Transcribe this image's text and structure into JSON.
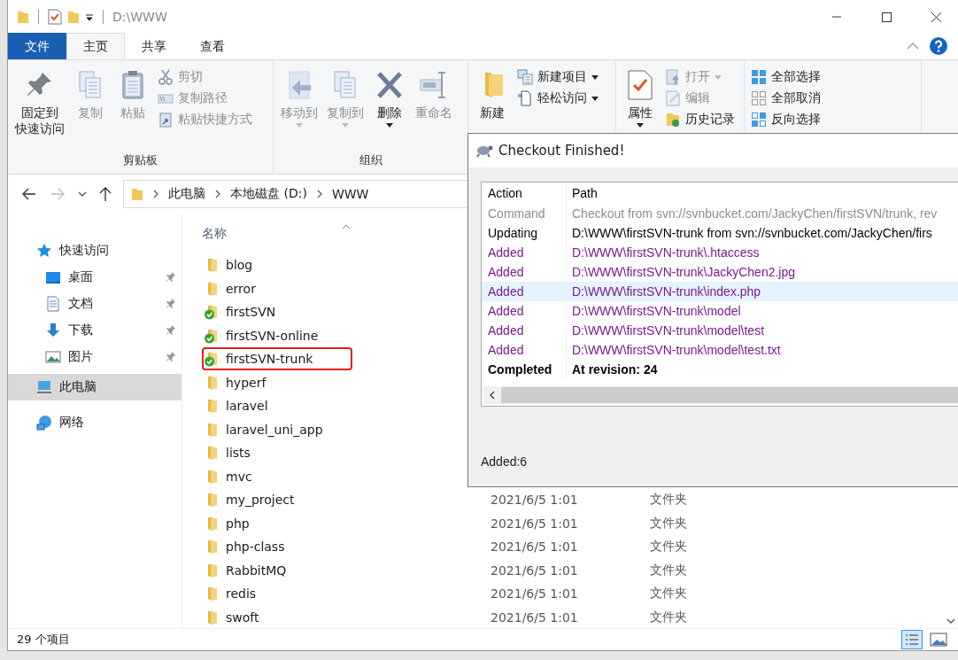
{
  "window": {
    "title": "D:\\WWW"
  },
  "ribbon_tabs": [
    {
      "label": "文件",
      "kind": "file",
      "selected": false
    },
    {
      "label": "主页",
      "kind": "tab",
      "selected": true
    },
    {
      "label": "共享",
      "kind": "tab",
      "selected": false
    },
    {
      "label": "查看",
      "kind": "tab",
      "selected": false
    }
  ],
  "ribbon_groups": [
    {
      "label": "剪贴板",
      "large": [
        {
          "lines": [
            "固定到",
            "快速访问"
          ],
          "kind": "pin",
          "disabled": false,
          "dropdown": false
        },
        {
          "label": "复制",
          "kind": "copy",
          "disabled": true,
          "dropdown": false
        },
        {
          "label": "粘贴",
          "kind": "paste",
          "disabled": true,
          "dropdown": false
        }
      ],
      "small": [
        {
          "label": "剪切",
          "kind": "cut",
          "disabled": true,
          "dropdown": false
        },
        {
          "label": "复制路径",
          "kind": "copy-path",
          "disabled": true,
          "dropdown": false
        },
        {
          "label": "粘贴快捷方式",
          "kind": "paste-shortcut",
          "disabled": true,
          "dropdown": false
        }
      ]
    },
    {
      "label": "组织",
      "large": [
        {
          "label": "移动到",
          "kind": "move",
          "disabled": true,
          "dropdown": true
        },
        {
          "label": "复制到",
          "kind": "copy-to",
          "disabled": true,
          "dropdown": true
        },
        {
          "label": "删除",
          "kind": "delete",
          "disabled": false,
          "dropdown": true
        },
        {
          "label": "重命名",
          "kind": "rename",
          "disabled": true,
          "dropdown": false
        }
      ]
    },
    {
      "large": [
        {
          "label": "新建",
          "kind": "new-folder",
          "disabled": false,
          "dropdown": false
        }
      ],
      "small": [
        {
          "label": "新建项目",
          "kind": "new-item",
          "disabled": false,
          "dropdown": true
        },
        {
          "label": "轻松访问",
          "kind": "easy-access",
          "disabled": false,
          "dropdown": true
        }
      ]
    },
    {
      "large": [
        {
          "label": "属性",
          "kind": "properties",
          "disabled": false,
          "dropdown": true
        }
      ],
      "small": [
        {
          "label": "打开",
          "kind": "open",
          "disabled": true,
          "dropdown": true
        },
        {
          "label": "编辑",
          "kind": "edit",
          "disabled": true,
          "dropdown": false
        },
        {
          "label": "历史记录",
          "kind": "history",
          "disabled": false,
          "dropdown": false
        }
      ]
    },
    {
      "small": [
        {
          "label": "全部选择",
          "kind": "select-all",
          "disabled": false,
          "dropdown": false
        },
        {
          "label": "全部取消",
          "kind": "select-none",
          "disabled": false,
          "dropdown": false
        },
        {
          "label": "反向选择",
          "kind": "invert",
          "disabled": false,
          "dropdown": false
        }
      ]
    }
  ],
  "breadcrumb": [
    "此电脑",
    "本地磁盘 (D:)",
    "WWW"
  ],
  "sidebar": [
    {
      "label": "快速访问",
      "kind": "quick",
      "pinned": false,
      "selected": false
    },
    {
      "label": "桌面",
      "kind": "desktop",
      "pinned": true,
      "selected": false
    },
    {
      "label": "文档",
      "kind": "documents",
      "pinned": true,
      "selected": false
    },
    {
      "label": "下载",
      "kind": "downloads",
      "pinned": true,
      "selected": false
    },
    {
      "label": "图片",
      "kind": "pictures",
      "pinned": true,
      "selected": false
    },
    {
      "label": "此电脑",
      "kind": "pc",
      "pinned": false,
      "selected": true
    },
    {
      "label": "网络",
      "kind": "network",
      "pinned": false,
      "selected": false
    }
  ],
  "file_list": {
    "columns": [
      "名称"
    ],
    "rows": [
      {
        "name": "blog",
        "versioned": false,
        "highlighted": false
      },
      {
        "name": "error",
        "versioned": false,
        "highlighted": false
      },
      {
        "name": "firstSVN",
        "versioned": true,
        "highlighted": false
      },
      {
        "name": "firstSVN-online",
        "versioned": true,
        "highlighted": false
      },
      {
        "name": "firstSVN-trunk",
        "versioned": true,
        "highlighted": true
      },
      {
        "name": "hyperf",
        "versioned": false,
        "highlighted": false
      },
      {
        "name": "laravel",
        "versioned": false,
        "highlighted": false
      },
      {
        "name": "laravel_uni_app",
        "versioned": false,
        "highlighted": false
      },
      {
        "name": "lists",
        "versioned": false,
        "highlighted": false
      },
      {
        "name": "mvc",
        "versioned": false,
        "highlighted": false
      },
      {
        "name": "my_project",
        "date": "2021/6/5 1:01",
        "type": "文件夹",
        "versioned": false,
        "highlighted": false
      },
      {
        "name": "php",
        "date": "2021/6/5 1:01",
        "type": "文件夹",
        "versioned": false,
        "highlighted": false
      },
      {
        "name": "php-class",
        "date": "2021/6/5 1:01",
        "type": "文件夹",
        "versioned": false,
        "highlighted": false
      },
      {
        "name": "RabbitMQ",
        "date": "2021/6/5 1:01",
        "type": "文件夹",
        "versioned": false,
        "highlighted": false
      },
      {
        "name": "redis",
        "date": "2021/6/5 1:01",
        "type": "文件夹",
        "versioned": false,
        "highlighted": false
      },
      {
        "name": "swoft",
        "date": "2021/6/5 1:01",
        "type": "文件夹",
        "versioned": false,
        "highlighted": false
      }
    ]
  },
  "status_bar": {
    "count": "29 个项目"
  },
  "dialog": {
    "title": "Checkout Finished!",
    "columns": [
      "Action",
      "Path"
    ],
    "rows": [
      {
        "kind": "command",
        "action": "Command",
        "path": "Checkout from svn://svnbucket.com/JackyChen/firstSVN/trunk, rev",
        "selected": false
      },
      {
        "kind": "updating",
        "action": "Updating",
        "path": "D:\\WWW\\firstSVN-trunk from svn://svnbucket.com/JackyChen/firs",
        "selected": false
      },
      {
        "kind": "added",
        "action": "Added",
        "path": "D:\\WWW\\firstSVN-trunk\\.htaccess",
        "selected": false
      },
      {
        "kind": "added",
        "action": "Added",
        "path": "D:\\WWW\\firstSVN-trunk\\JackyChen2.jpg",
        "selected": false
      },
      {
        "kind": "added",
        "action": "Added",
        "path": "D:\\WWW\\firstSVN-trunk\\index.php",
        "selected": true
      },
      {
        "kind": "added",
        "action": "Added",
        "path": "D:\\WWW\\firstSVN-trunk\\model",
        "selected": false
      },
      {
        "kind": "added",
        "action": "Added",
        "path": "D:\\WWW\\firstSVN-trunk\\model\\test",
        "selected": false
      },
      {
        "kind": "added",
        "action": "Added",
        "path": "D:\\WWW\\firstSVN-trunk\\model\\test.txt",
        "selected": false
      },
      {
        "kind": "completed",
        "action": "Completed",
        "path": "At revision: 24",
        "selected": false
      }
    ],
    "summary": "Added:6"
  }
}
